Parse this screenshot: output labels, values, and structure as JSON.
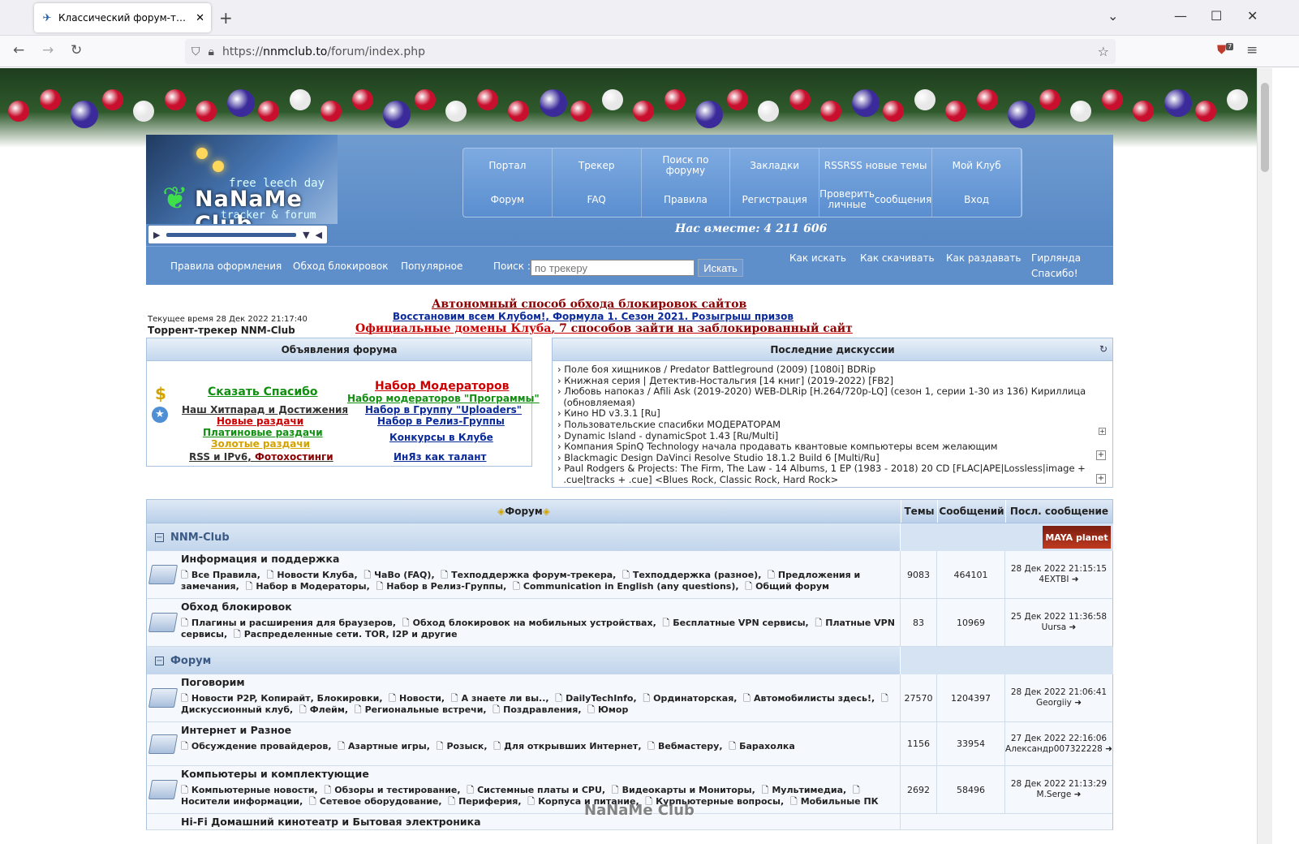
{
  "browser": {
    "tab_title": "Классический форум-трекер",
    "url_scheme": "https://",
    "url_host": "nnmclub.to",
    "url_path": "/forum/index.php",
    "ext_badge": "7"
  },
  "header": {
    "logo": {
      "line1": "free leech day",
      "line2": "NaNaMe Club",
      "line3": "tracker & forum"
    },
    "menu": [
      [
        "Портал"
      ],
      [
        "Трекер"
      ],
      [
        "Поиск по форуму"
      ],
      [
        "Закладки"
      ],
      [
        "RSS",
        "RSS новые темы"
      ],
      [
        "Мой Клуб"
      ],
      [
        "Форум"
      ],
      [
        "FAQ"
      ],
      [
        "Правила"
      ],
      [
        "Регистрация"
      ],
      [
        "Проверить личные",
        "сообщения"
      ],
      [
        "Вход"
      ]
    ],
    "together": "Нас вместе: 4 211 606",
    "links": {
      "rules": "Правила оформления",
      "bypass": "Обход блокировок",
      "popular": "Популярное",
      "search_label": "Поиск :",
      "search_placeholder": "по трекеру",
      "search_btn": "Искать",
      "howsearch": "Как искать",
      "howdl": "Как скачивать",
      "howseed": "Как раздавать",
      "garland": "Гирлянда",
      "thanks": "Спасибо!"
    }
  },
  "notices": {
    "n1": "Автономный способ обхода блокировок сайтов",
    "n2a": "Восстановим всем Клубом!",
    "n2b": "Формула 1. Сезон 2021. Розыгрыш призов",
    "n3a": "Официальные домены Клуба",
    "n3b": "7 способов зайти на заблокированный сайт"
  },
  "curtime": "Текущее время 28 Дек 2022 21:17:40",
  "tracker_name": "Торрент-трекер NNM-Club",
  "ann": {
    "title": "Объявления форума",
    "say_thanks": "Сказать Спасибо",
    "hitparade": "Наш Хитпарад и Достижения",
    "new": "Новые раздачи",
    "paid": "Платиновые раздачи",
    "gold": "Золотые раздачи",
    "rss": "RSS и IPv6",
    "photo": "Фотохостинги",
    "mods": "Набор Модераторов",
    "mods_prog": "Набор модераторов \"Программы\"",
    "uploaders": "Набор в Группу \"Uploaders\"",
    "release": "Набор в Релиз-Группы",
    "contests": "Конкурсы в Клубе",
    "inyaz": "ИнЯз как талант"
  },
  "disc": {
    "title": "Последние дискуссии",
    "items": [
      "Поле боя хищников / Predator Battleground (2009) [1080i] BDRip",
      "Книжная серия | Детектив-Ностальгия [14 книг] (2019-2022) [FB2]",
      "Любовь напоказ / Afili Ask (2019-2020) WEB-DLRip [H.264/720p-LQ] (сезон 1, серии 1-30 из 136) Кириллица",
      "(обновляемая)",
      "Кино HD v3.3.1 [Ru]",
      "Пользовательские спасибки МОДЕРАТОРАМ",
      "Dynamic Island - dynamicSpot 1.43 [Ru/Multi]",
      "Компания SpinQ Technology начала продавать квантовые компьютеры всем желающим",
      "Blackmagic Design DaVinci Resolve Studio 18.1.2 Build 6 [Multi/Ru]",
      "Paul Rodgers & Projects: The Firm, The Law - 14 Albums, 1 EP (1983 - 2018) 20 CD [FLAC|APE|Lossless|image +",
      ".cue|tracks + .cue] <Blues Rock, Classic Rock, Hard Rock>"
    ]
  },
  "table": {
    "h_forum": "Форум",
    "h_topics": "Темы",
    "h_posts": "Сообщений",
    "h_last": "Посл. сообщение",
    "cat1": "NNM-Club",
    "cat2": "Форум",
    "sponsor": "MAYA planet",
    "rows": [
      {
        "title": "Информация и поддержка",
        "subs": [
          "Все Правила",
          "Новости Клуба",
          "ЧаВо (FAQ)",
          "Техподдержка форум-трекера",
          "Техподдержка (разное)",
          "Предложения и замечания",
          "Набор в Модераторы",
          "Набор в Релиз-Группы",
          "Communication in English (any questions)",
          "Общий форум"
        ],
        "topics": "9083",
        "posts": "464101",
        "date": "28 Дек 2022 21:15:15",
        "user": "4EXTBI"
      },
      {
        "title": "Обход блокировок",
        "subs": [
          "Плагины и расширения для браузеров",
          "Обход блокировок на мобильных устройствах",
          "Бесплатные VPN сервисы",
          "Платные VPN сервисы",
          "Распределенные сети. TOR, I2P и другие"
        ],
        "topics": "83",
        "posts": "10969",
        "date": "25 Дек 2022 11:36:58",
        "user": "Uursa"
      },
      {
        "title": "Поговорим",
        "subs": [
          "Новости P2P, Копирайт, Блокировки",
          "Новости",
          "А знаете ли вы..",
          "DailyTechInfo",
          "Ординаторская",
          "Автомобилисты здесь!",
          "Дискуссионный клуб",
          "Флейм",
          "Региональные встречи",
          "Поздравления",
          "Юмор"
        ],
        "topics": "27570",
        "posts": "1204397",
        "date": "28 Дек 2022 21:06:41",
        "user": "Georgiiy"
      },
      {
        "title": "Интернет и Разное",
        "subs": [
          "Обсуждение провайдеров",
          "Азартные игры",
          "Розыск",
          "Для открывших Интернет",
          "Вебмастеру",
          "Барахолка"
        ],
        "topics": "1156",
        "posts": "33954",
        "date": "27 Дек 2022 22:16:06",
        "user": "Александр007322228"
      },
      {
        "title": "Компьютеры и комплектующие",
        "subs": [
          "Компьютерные новости",
          "Обзоры и тестирование",
          "Системные платы и CPU",
          "Видеокарты и Мониторы",
          "Мультимедиа",
          "Носители информации",
          "Сетевое оборудование",
          "Периферия",
          "Корпуса и питание",
          "Курпьютерные вопросы",
          "Мобильные ПК"
        ],
        "topics": "2692",
        "posts": "58496",
        "date": "28 Дек 2022 21:13:29",
        "user": "M.Serge"
      }
    ],
    "next_row": "Hi-Fi Домашний кинотеатр и Бытовая электроника"
  },
  "watermark": "NaNaMe Club"
}
